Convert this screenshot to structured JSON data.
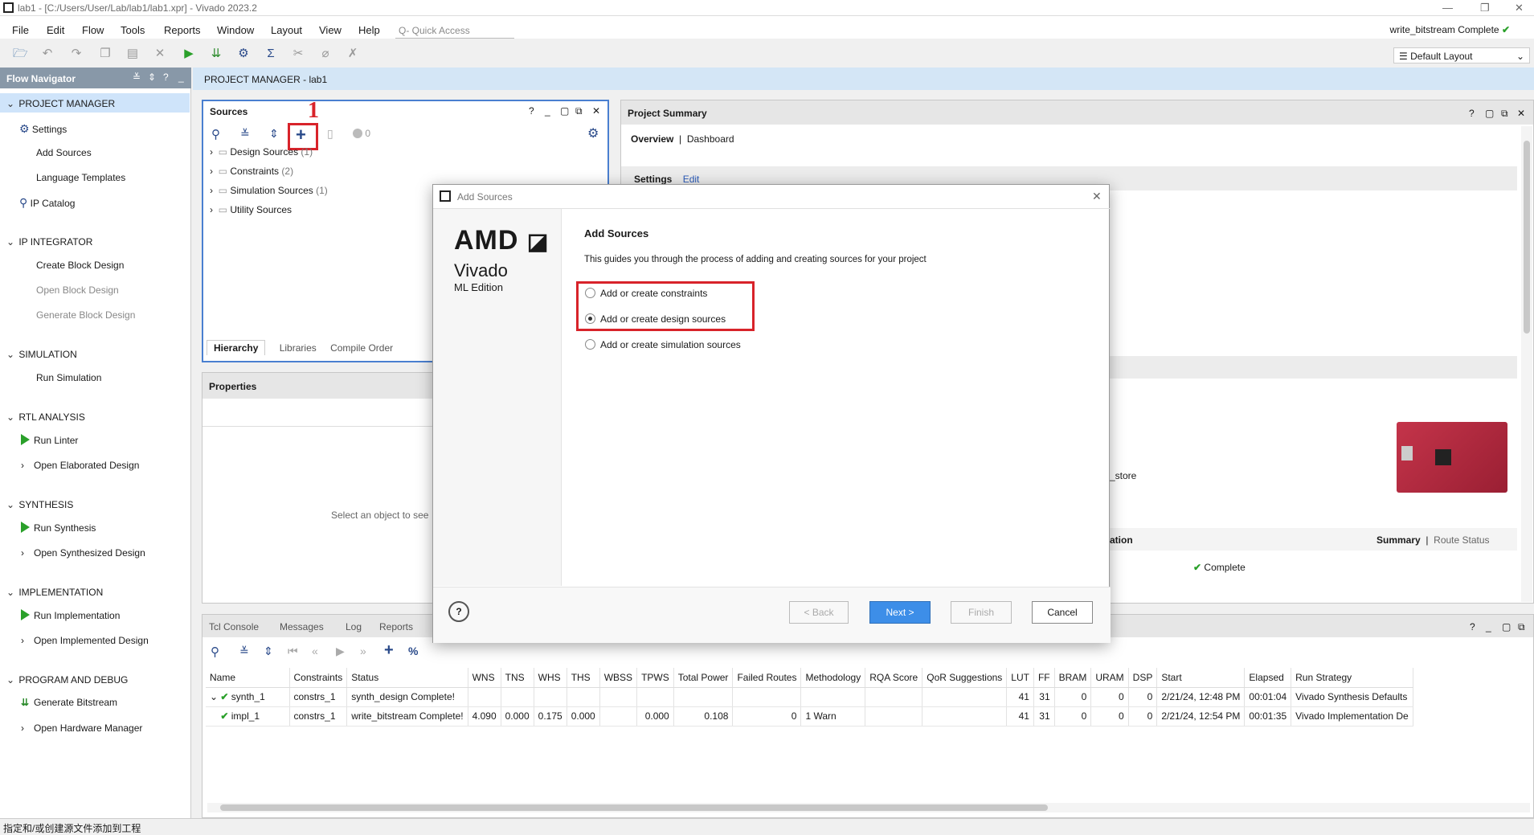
{
  "window": {
    "title": "lab1 - [C:/Users/User/Lab/lab1/lab1.xpr] - Vivado 2023.2",
    "status_right": "write_bitstream Complete"
  },
  "menu": [
    "File",
    "Edit",
    "Flow",
    "Tools",
    "Reports",
    "Window",
    "Layout",
    "View",
    "Help"
  ],
  "quick_access": {
    "placeholder": "Q- Quick Access"
  },
  "layout_select": "Default Layout",
  "flow_navigator": {
    "title": "Flow Navigator",
    "sections": [
      {
        "title": "PROJECT MANAGER",
        "items": [
          {
            "label": "Settings",
            "icon": "gear-icon"
          },
          {
            "label": "Add Sources"
          },
          {
            "label": "Language Templates"
          },
          {
            "label": "IP Catalog",
            "icon": "ip-icon"
          }
        ]
      },
      {
        "title": "IP INTEGRATOR",
        "items": [
          {
            "label": "Create Block Design"
          },
          {
            "label": "Open Block Design",
            "disabled": true
          },
          {
            "label": "Generate Block Design",
            "disabled": true
          }
        ]
      },
      {
        "title": "SIMULATION",
        "items": [
          {
            "label": "Run Simulation"
          }
        ]
      },
      {
        "title": "RTL ANALYSIS",
        "items": [
          {
            "label": "Run Linter",
            "icon": "run-icon"
          },
          {
            "label": "Open Elaborated Design",
            "expand": true
          }
        ]
      },
      {
        "title": "SYNTHESIS",
        "items": [
          {
            "label": "Run Synthesis",
            "icon": "run-icon"
          },
          {
            "label": "Open Synthesized Design",
            "expand": true
          }
        ]
      },
      {
        "title": "IMPLEMENTATION",
        "items": [
          {
            "label": "Run Implementation",
            "icon": "run-icon"
          },
          {
            "label": "Open Implemented Design",
            "expand": true
          }
        ]
      },
      {
        "title": "PROGRAM AND DEBUG",
        "items": [
          {
            "label": "Generate Bitstream",
            "icon": "bitstream-icon"
          },
          {
            "label": "Open Hardware Manager",
            "expand": true
          }
        ]
      }
    ]
  },
  "project_manager": {
    "header": "PROJECT MANAGER - lab1"
  },
  "sources": {
    "title": "Sources",
    "annotation_number": "1",
    "count": "0",
    "tree": [
      {
        "label": "Design Sources",
        "count": "(1)"
      },
      {
        "label": "Constraints",
        "count": "(2)"
      },
      {
        "label": "Simulation Sources",
        "count": "(1)"
      },
      {
        "label": "Utility Sources",
        "count": ""
      }
    ],
    "tabs": [
      "Hierarchy",
      "Libraries",
      "Compile Order"
    ]
  },
  "properties": {
    "title": "Properties",
    "placeholder": "Select an object to see"
  },
  "summary": {
    "title": "Project Summary",
    "tabs": [
      "Overview",
      "Dashboard"
    ],
    "settings_label": "Settings",
    "edit_label": "Edit",
    "partial_store": "_store",
    "partial_ation": "ation",
    "summary_tab": "Summary",
    "route_status_tab": "Route Status",
    "complete": "Complete"
  },
  "dialog": {
    "title": "Add Sources",
    "brand_top": "AMD",
    "brand_product": "Vivado",
    "brand_edition": "ML Edition",
    "heading": "Add Sources",
    "description": "This guides you through the process of adding and creating sources for your project",
    "options": [
      {
        "label": "Add or create constraints",
        "selected": false
      },
      {
        "label": "Add or create design sources",
        "selected": true
      },
      {
        "label": "Add or create simulation sources",
        "selected": false
      }
    ],
    "buttons": {
      "back": "< Back",
      "next": "Next >",
      "finish": "Finish",
      "cancel": "Cancel"
    }
  },
  "bottom": {
    "tabs": [
      "Tcl Console",
      "Messages",
      "Log",
      "Reports"
    ],
    "columns": [
      "Name",
      "Constraints",
      "Status",
      "WNS",
      "TNS",
      "WHS",
      "THS",
      "WBSS",
      "TPWS",
      "Total Power",
      "Failed Routes",
      "Methodology",
      "RQA Score",
      "QoR Suggestions",
      "LUT",
      "FF",
      "BRAM",
      "URAM",
      "DSP",
      "Start",
      "Elapsed",
      "Run Strategy"
    ],
    "rows": [
      [
        "synth_1",
        "constrs_1",
        "synth_design Complete!",
        "",
        "",
        "",
        "",
        "",
        "",
        "",
        "",
        "",
        "",
        "",
        "41",
        "31",
        "0",
        "0",
        "0",
        "2/21/24, 12:48 PM",
        "00:01:04",
        "Vivado Synthesis Defaults"
      ],
      [
        "impl_1",
        "constrs_1",
        "write_bitstream Complete!",
        "4.090",
        "0.000",
        "0.175",
        "0.000",
        "",
        "0.000",
        "0.108",
        "0",
        "1 Warn",
        "",
        "",
        "41",
        "31",
        "0",
        "0",
        "0",
        "2/21/24, 12:54 PM",
        "00:01:35",
        "Vivado Implementation De"
      ]
    ]
  },
  "status_bar": "指定和/或创建源文件添加到工程"
}
